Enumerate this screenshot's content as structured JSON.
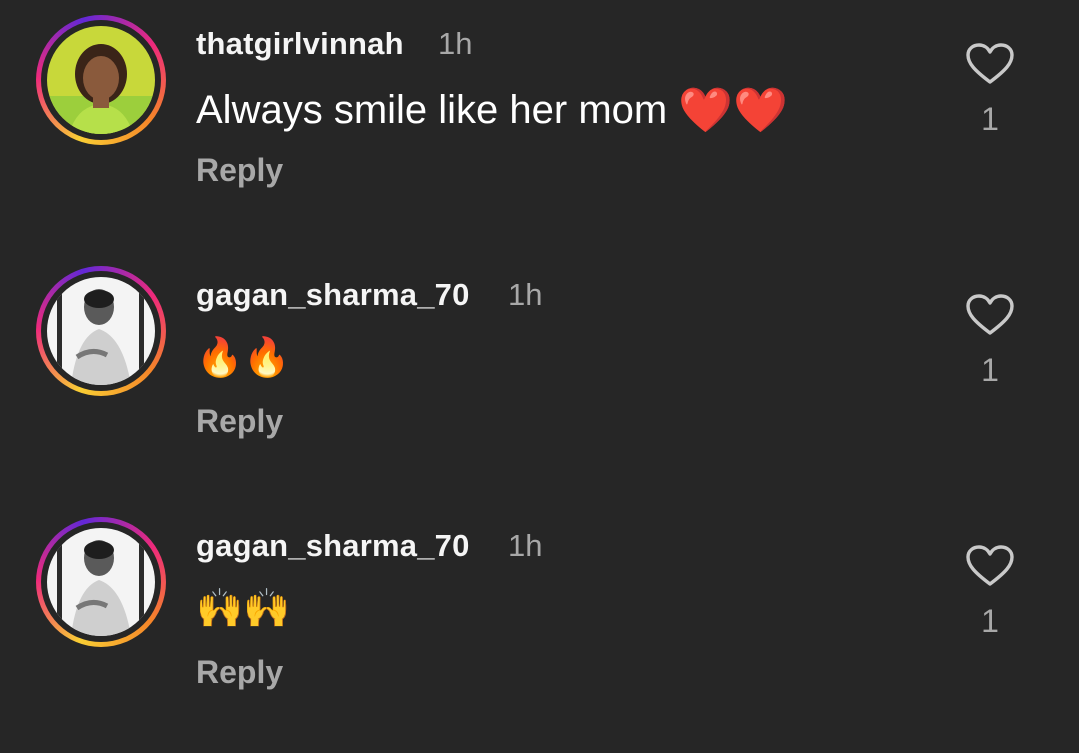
{
  "comments": [
    {
      "username": "thatgirlvinnah",
      "time": "1h",
      "text": "Always smile like her mom",
      "emoji": "❤️❤️",
      "reply_label": "Reply",
      "likes": "1",
      "icon": "heart-outline-icon"
    },
    {
      "username": "gagan_sharma_70",
      "time": "1h",
      "text": "",
      "emoji": "🔥🔥",
      "reply_label": "Reply",
      "likes": "1",
      "icon": "heart-outline-icon"
    },
    {
      "username": "gagan_sharma_70",
      "time": "1h",
      "text": "",
      "emoji": "🙌🙌",
      "reply_label": "Reply",
      "likes": "1",
      "icon": "heart-outline-icon"
    }
  ],
  "colors": {
    "background": "#262626",
    "secondary_text": "#a8a8a8",
    "story_ring": [
      "#f9ce34",
      "#ee2a7b",
      "#6228d7"
    ]
  }
}
